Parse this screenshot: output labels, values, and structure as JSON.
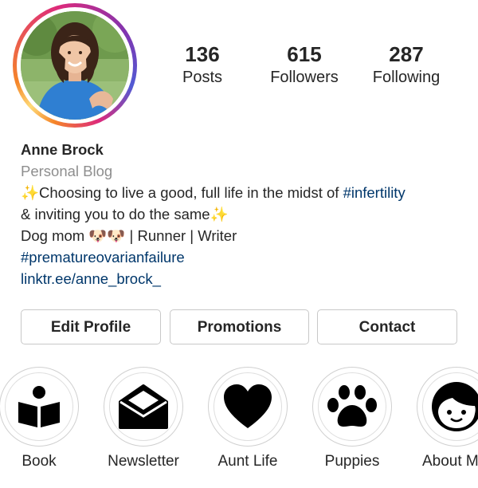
{
  "profile": {
    "avatar_icon": "profile-photo",
    "story_ring_colors": [
      "#f58529",
      "#dd2a7b",
      "#8134af",
      "#515bd4"
    ]
  },
  "stats": {
    "posts": {
      "value": "136",
      "label": "Posts"
    },
    "followers": {
      "value": "615",
      "label": "Followers"
    },
    "following": {
      "value": "287",
      "label": "Following"
    }
  },
  "bio": {
    "name": "Anne Brock",
    "category": "Personal Blog",
    "line1_text": "✨Choosing to live a good, full life in the midst of ",
    "line1_hashtag": "#infertility",
    "line2_text": "& inviting you to do the same✨",
    "line3_text": "Dog mom 🐶🐶 | Runner | Writer",
    "line4_hashtag": "#prematureovarianfailure",
    "link": "linktr.ee/anne_brock_",
    "link_color": "#00376b"
  },
  "buttons": {
    "edit_profile": "Edit Profile",
    "promotions": "Promotions",
    "contact": "Contact"
  },
  "highlights": [
    {
      "label": "Book",
      "icon": "book-reader-icon"
    },
    {
      "label": "Newsletter",
      "icon": "envelope-icon"
    },
    {
      "label": "Aunt Life",
      "icon": "heart-icon"
    },
    {
      "label": "Puppies",
      "icon": "paw-icon"
    },
    {
      "label": "About M",
      "icon": "face-icon"
    }
  ]
}
